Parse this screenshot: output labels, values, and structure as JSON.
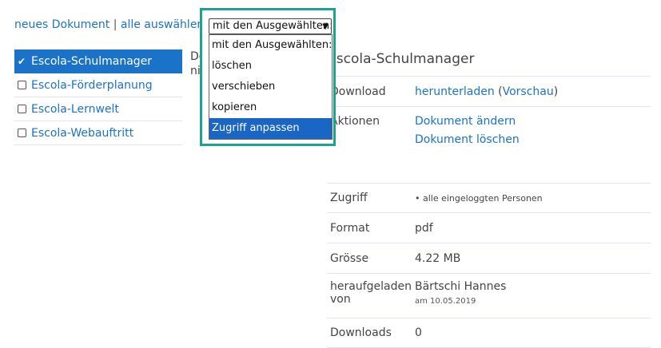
{
  "top_links": {
    "new_doc": "neues Dokument",
    "separator": "|",
    "select_all": "alle auswählen"
  },
  "files": [
    {
      "name": "Escola-Schulmanager",
      "selected": true
    },
    {
      "name": "Escola-Förderplanung",
      "selected": false
    },
    {
      "name": "Escola-Lernwelt",
      "selected": false
    },
    {
      "name": "Escola-Webauftritt",
      "selected": false
    }
  ],
  "behind_text": {
    "line1": "De",
    "line2": "nic"
  },
  "dropdown": {
    "selected": "mit den Ausgewählten:",
    "options": [
      "mit den Ausgewählten:",
      "löschen",
      "verschieben",
      "kopieren",
      "Zugriff anpassen"
    ],
    "highlighted_index": 4
  },
  "detail": {
    "title": "Escola-Schulmanager",
    "download_label": "Download",
    "download_link": "herunterladen",
    "preview_link": "Vorschau",
    "actions_label": "Aktionen",
    "edit_link": "Dokument ändern",
    "delete_link": "Dokument löschen",
    "access_label": "Zugriff",
    "access_value": "• alle eingeloggten Personen",
    "format_label": "Format",
    "format_value": "pdf",
    "size_label": "Grösse",
    "size_value": "4.22 MB",
    "uploaded_label": "heraufgeladen von",
    "uploaded_by": "Bärtschi Hannes",
    "uploaded_date": "am 10.05.2019",
    "downloads_label": "Downloads",
    "downloads_value": "0"
  },
  "colors": {
    "accent": "#1a73c8",
    "highlight_border": "#1aa394",
    "selected_bg": "#1a73c8"
  }
}
